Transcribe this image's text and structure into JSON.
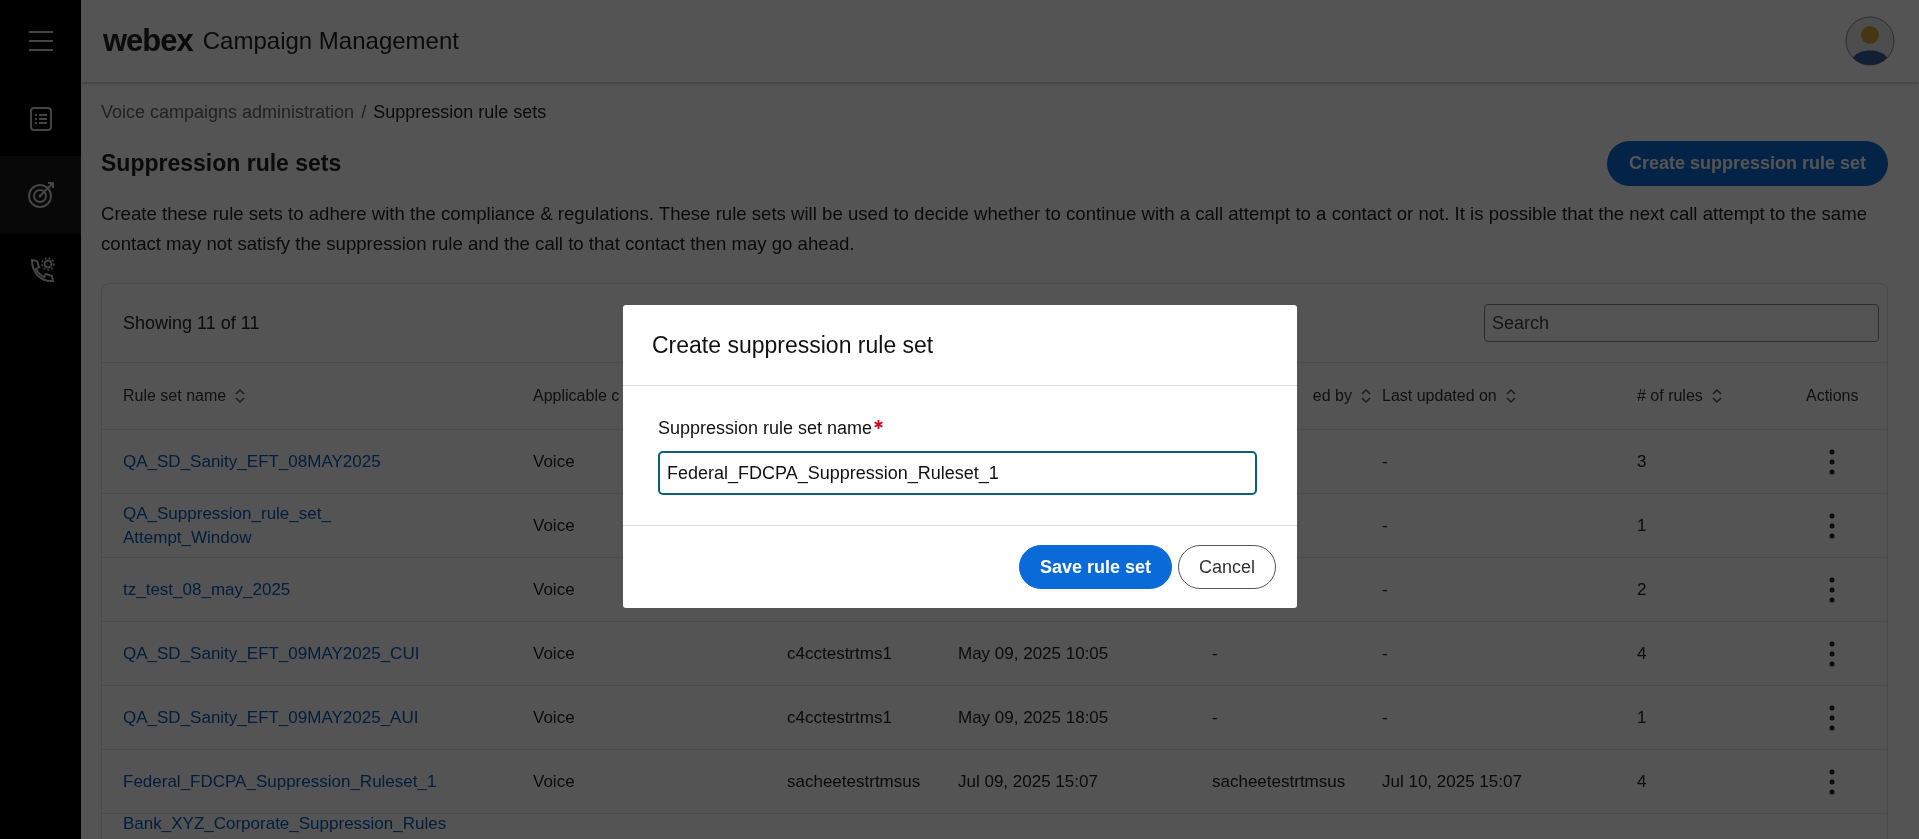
{
  "sidebar": {
    "items": [
      {
        "kind": "list",
        "selected": false
      },
      {
        "kind": "target",
        "selected": true
      },
      {
        "kind": "phone",
        "selected": false
      }
    ]
  },
  "header": {
    "brand": "webex",
    "title": "Campaign Management"
  },
  "breadcrumb": {
    "items": [
      {
        "label": "Voice campaigns administration",
        "current": false
      },
      {
        "label": "Suppression rule sets",
        "current": true
      }
    ],
    "separator": "/"
  },
  "page": {
    "title": "Suppression rule sets",
    "create_button": "Create suppression rule set",
    "description": "Create these rule sets to adhere with the compliance & regulations. These rule sets will be used to decide whether to continue with a call attempt to a contact or not. It is possible that the next call attempt to the same contact may not satisfy the suppression rule and the call to that contact then may go ahead."
  },
  "table": {
    "summary": "Showing 11 of 11",
    "search": {
      "placeholder": "Search"
    },
    "columns": [
      {
        "label": "Rule set name",
        "sortable": true
      },
      {
        "label": "Applicable c"
      },
      {},
      {},
      {
        "label": "ed by",
        "sortable": true,
        "cut": true
      },
      {
        "label": "Last updated on",
        "sortable": true
      },
      {
        "label": "# of rules",
        "sortable": true
      },
      {
        "label": "Actions",
        "sortable": false
      }
    ],
    "rows": [
      {
        "name": "QA_SD_Sanity_EFT_08MAY2025",
        "channel": "Voice",
        "updated_on": "-",
        "rules": "3"
      },
      {
        "name": "QA_Suppression_rule_set_ Attempt_Window",
        "channel": "Voice",
        "updated_on": "-",
        "rules": "1"
      },
      {
        "name": "tz_test_08_may_2025",
        "channel": "Voice",
        "updated_on": "-",
        "rules": "2"
      },
      {
        "name": "QA_SD_Sanity_EFT_09MAY2025_CUI",
        "channel": "Voice",
        "created_by": "c4cctestrtms1",
        "created_on": "May 09, 2025 10:05",
        "updated_by": "-",
        "updated_on": "-",
        "rules": "4"
      },
      {
        "name": "QA_SD_Sanity_EFT_09MAY2025_AUI",
        "channel": "Voice",
        "created_by": "c4cctestrtms1",
        "created_on": "May 09, 2025 18:05",
        "updated_by": "-",
        "updated_on": "-",
        "rules": "1"
      },
      {
        "name": "Federal_FDCPA_Suppression_Ruleset_1",
        "channel": "Voice",
        "created_by": "sacheetestrtmsus",
        "created_on": "Jul 09, 2025 15:07",
        "updated_by": "sacheetestrtmsus",
        "updated_on": "Jul 10, 2025 15:07",
        "rules": "4"
      },
      {
        "name": "Bank_XYZ_Corporate_Suppression_Rules"
      }
    ]
  },
  "dialog": {
    "title": "Create suppression rule set",
    "field": {
      "label": "Suppression rule set name",
      "required": true,
      "value": "Federal_FDCPA_Suppression_Ruleset_1"
    },
    "buttons": [
      {
        "label": "Save rule set",
        "kind": "primary"
      },
      {
        "label": "Cancel",
        "kind": "secondary"
      }
    ]
  }
}
